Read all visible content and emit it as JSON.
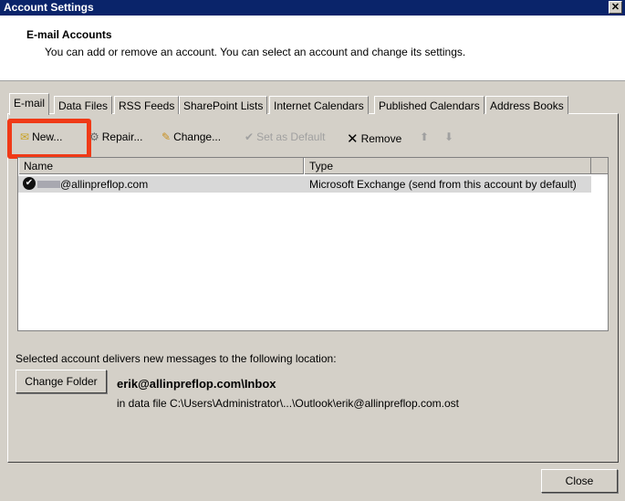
{
  "window": {
    "title": "Account Settings"
  },
  "header": {
    "title": "E-mail Accounts",
    "description": "You can add or remove an account. You can select an account and change its settings."
  },
  "tabs": [
    "E-mail",
    "Data Files",
    "RSS Feeds",
    "SharePoint Lists",
    "Internet Calendars",
    "Published Calendars",
    "Address Books"
  ],
  "toolbar": {
    "new": "New...",
    "repair": "Repair...",
    "change": "Change...",
    "set_default": "Set as Default",
    "remove": "Remove"
  },
  "list": {
    "columns": [
      "Name",
      "Type"
    ],
    "rows": [
      {
        "name": "@allinpreflop.com",
        "type": "Microsoft Exchange (send from this account by default)"
      }
    ]
  },
  "delivery": {
    "label": "Selected account delivers new messages to the following location:",
    "change_folder": "Change Folder",
    "folder": "erik@allinpreflop.com\\Inbox",
    "data_file": "in data file C:\\Users\\Administrator\\...\\Outlook\\erik@allinpreflop.com.ost"
  },
  "footer": {
    "close": "Close"
  },
  "colors": {
    "titlebar": "#0a246a",
    "highlight": "#f03a17"
  }
}
